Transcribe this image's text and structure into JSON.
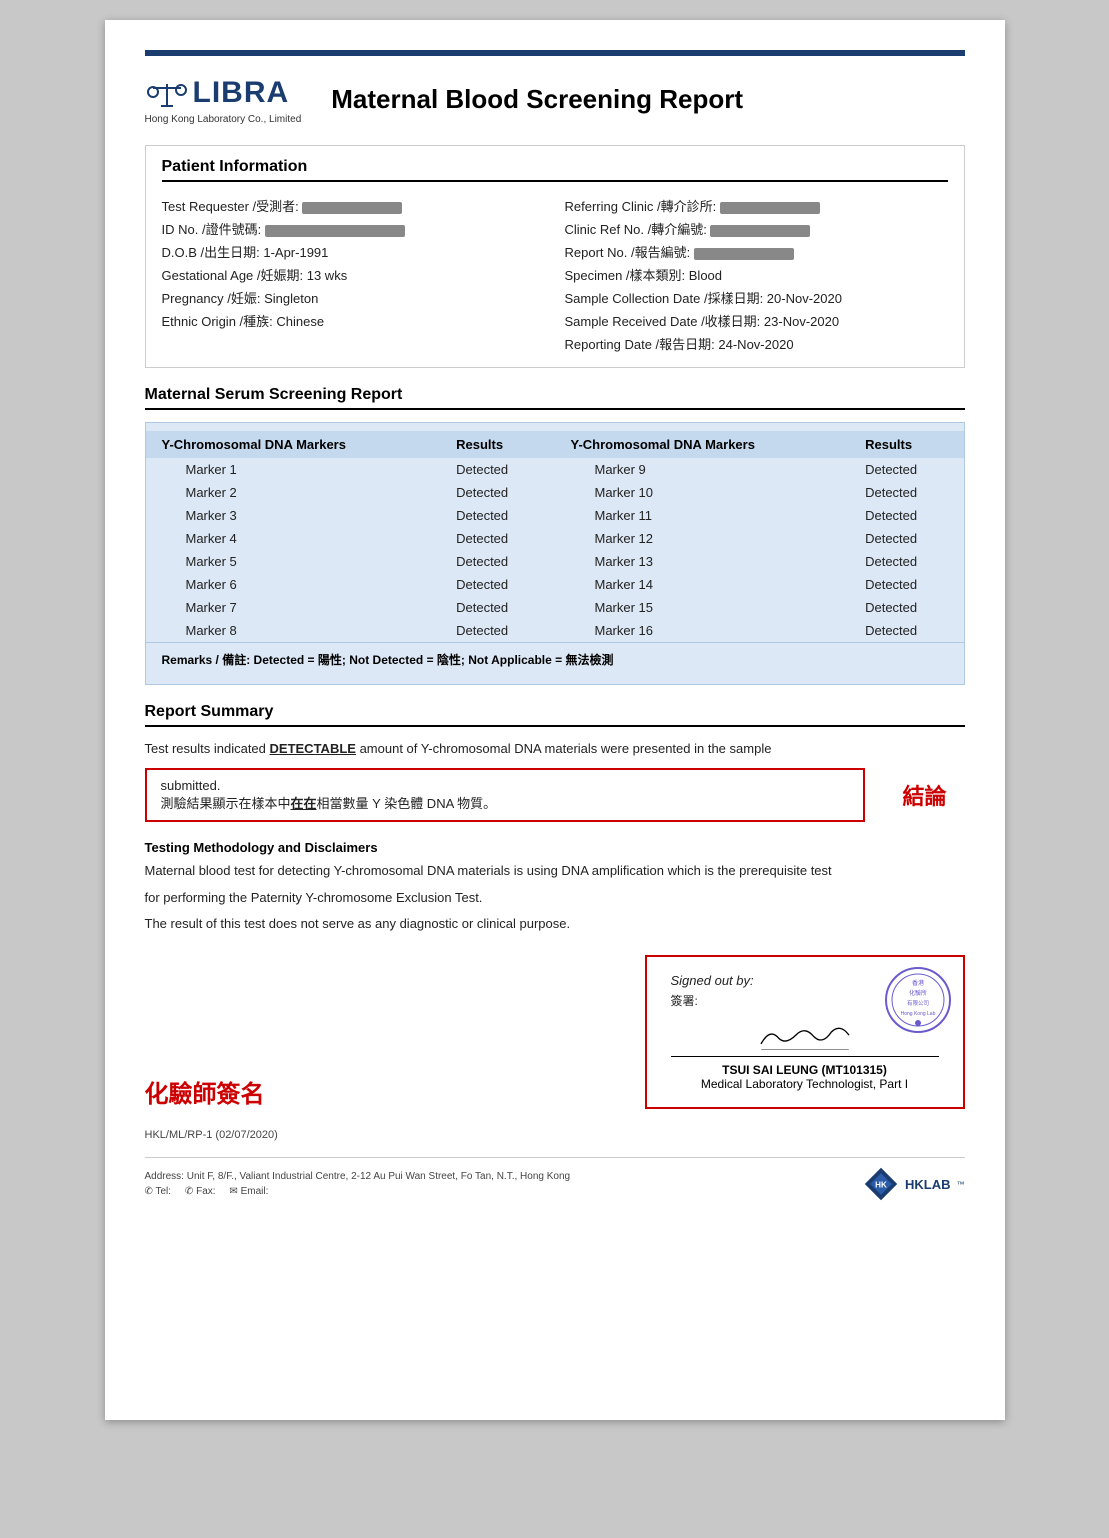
{
  "header": {
    "logo_name": "LIBRA",
    "logo_subtitle": "Hong Kong Laboratory Co., Limited",
    "report_title": "Maternal Blood Screening Report"
  },
  "patient_info": {
    "section_title": "Patient Information",
    "left_fields": [
      {
        "label": "Test Requester /受測者:",
        "value": "REDACTED"
      },
      {
        "label": "ID No. /證件號碼:",
        "value": "REDACTED"
      },
      {
        "label": "D.O.B /出生日期:",
        "value": "1-Apr-1991"
      },
      {
        "label": "Gestational Age /妊娠期:",
        "value": "13 wks"
      },
      {
        "label": "Pregnancy /妊娠:",
        "value": "Singleton"
      },
      {
        "label": "Ethnic Origin /種族:",
        "value": "Chinese"
      }
    ],
    "right_fields": [
      {
        "label": "Referring Clinic /轉介診所:",
        "value": "REDACTED"
      },
      {
        "label": "Clinic Ref No. /轉介編號:",
        "value": "REDACTED"
      },
      {
        "label": "Report No. /報告編號:",
        "value": "REDACTED"
      },
      {
        "label": "Specimen /樣本類別:",
        "value": "Blood"
      },
      {
        "label": "Sample Collection Date /採樣日期:",
        "value": "20-Nov-2020"
      },
      {
        "label": "Sample Received Date /收樣日期:",
        "value": "23-Nov-2020"
      },
      {
        "label": "Reporting Date /報告日期:",
        "value": "24-Nov-2020"
      }
    ]
  },
  "serum_screening": {
    "section_title": "Maternal Serum Screening Report",
    "col1_header": "Y-Chromosomal DNA Markers",
    "col2_header": "Results",
    "col3_header": "Y-Chromosomal DNA Markers",
    "col4_header": "Results",
    "left_markers": [
      {
        "name": "Marker 1",
        "result": "Detected"
      },
      {
        "name": "Marker 2",
        "result": "Detected"
      },
      {
        "name": "Marker 3",
        "result": "Detected"
      },
      {
        "name": "Marker 4",
        "result": "Detected"
      },
      {
        "name": "Marker 5",
        "result": "Detected"
      },
      {
        "name": "Marker 6",
        "result": "Detected"
      },
      {
        "name": "Marker 7",
        "result": "Detected"
      },
      {
        "name": "Marker 8",
        "result": "Detected"
      }
    ],
    "right_markers": [
      {
        "name": "Marker 9",
        "result": "Detected"
      },
      {
        "name": "Marker 10",
        "result": "Detected"
      },
      {
        "name": "Marker 11",
        "result": "Detected"
      },
      {
        "name": "Marker 12",
        "result": "Detected"
      },
      {
        "name": "Marker 13",
        "result": "Detected"
      },
      {
        "name": "Marker 14",
        "result": "Detected"
      },
      {
        "name": "Marker 15",
        "result": "Detected"
      },
      {
        "name": "Marker 16",
        "result": "Detected"
      }
    ],
    "remarks": "Remarks / 備註: Detected = 陽性; Not Detected = 陰性; Not Applicable = 無法檢測"
  },
  "report_summary": {
    "section_title": "Report Summary",
    "summary_line1": "Test results indicated ",
    "summary_highlight": "DETECTABLE",
    "summary_line2": " amount of Y-chromosomal DNA materials were presented in the sample",
    "summary_line3": "submitted.",
    "submitted_box_text": "測驗結果顯示在樣本中",
    "submitted_box_underline": "在在",
    "submitted_box_end": "相當數量 Y 染色體 DNA 物質。",
    "conclusion_label": "結論"
  },
  "methodology": {
    "title": "Testing Methodology and Disclaimers",
    "text1": "Maternal blood test for detecting Y-chromosomal DNA materials is using DNA amplification which is the prerequisite test",
    "text2": "for performing the Paternity Y-chromosome Exclusion Test.",
    "text3": "The result of this test does not serve as any diagnostic or clinical purpose."
  },
  "signature": {
    "chemist_label": "化驗師簽名",
    "signed_out_label": "Signed out by:",
    "signed_chinese": "簽署:",
    "signer_name": "TSUI SAI LEUNG (MT101315)",
    "signer_title": "Medical Laboratory Technologist, Part I"
  },
  "footer": {
    "ref": "HKL/ML/RP-1 (02/07/2020)",
    "address": "Address: Unit F, 8/F., Valiant Industrial Centre, 2-12 Au Pui Wan Street, Fo Tan, N.T., Hong Kong",
    "hklab_text": "HKLAB"
  }
}
